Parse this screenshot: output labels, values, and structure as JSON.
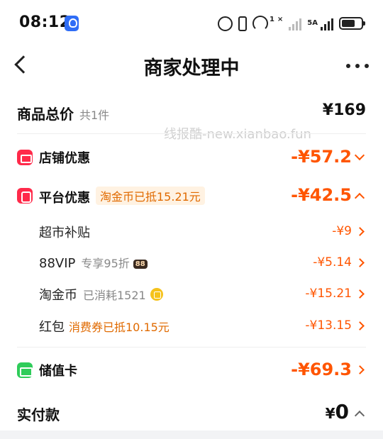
{
  "status_bar": {
    "time": "08:12",
    "hotspot_sup": "1",
    "sim_sup": "×",
    "net": "5A"
  },
  "header": {
    "title": "商家处理中"
  },
  "total": {
    "label": "商品总价",
    "count": "共1件",
    "amount": "¥169"
  },
  "watermark": "线报酷-new.xianbao.fun",
  "store_discount": {
    "label": "店铺优惠",
    "amount": "-¥57.2"
  },
  "platform_discount": {
    "label": "平台优惠",
    "tag": "淘金币已抵15.21元",
    "amount": "-¥42.5",
    "items": [
      {
        "label": "超市补贴",
        "note": "",
        "amount": "-¥9"
      },
      {
        "label": "88VIP",
        "note": "专享95折",
        "badge": "88",
        "amount": "-¥5.14"
      },
      {
        "label": "淘金币",
        "note": "已消耗1521",
        "amount": "-¥15.21"
      },
      {
        "label": "红包",
        "note": "消费券已抵10.15元",
        "amount": "-¥13.15"
      }
    ]
  },
  "stored_card": {
    "label": "储值卡",
    "amount": "-¥69.3"
  },
  "actual_payment": {
    "label": "实付款",
    "currency": "¥",
    "amount": "0"
  },
  "colors": {
    "accent": "#ff5500",
    "tag_text": "#e06a00",
    "tag_bg": "#fff2e2",
    "red_icon": "#ff2a4a",
    "green_icon": "#2fcc5a"
  }
}
